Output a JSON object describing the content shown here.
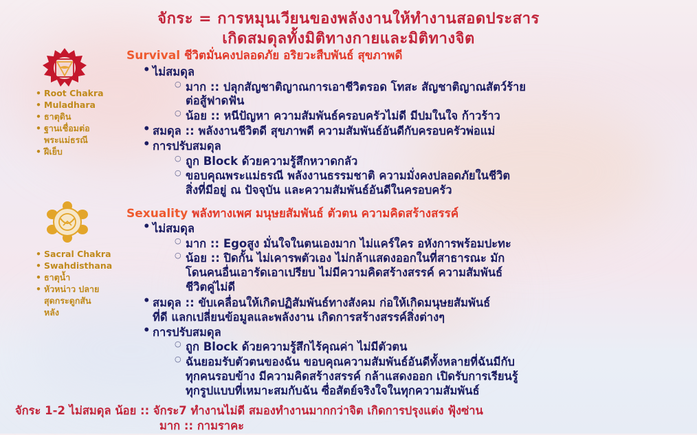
{
  "title": {
    "line1": "จักระ = การหมุนเวียนของพลังงานให้ทำงานสอดประสาร",
    "line2": "เกิดสมดุลทั้งมิติทางกายและมิติทางจิต"
  },
  "root": {
    "heading_en": "Survival",
    "heading_th": "ชีวิตมั่นคงปลอดภัย อริยวะสืบพันธ์ สุขภาพดี",
    "side_items": [
      "Root Chakra",
      "Muladhara",
      "ธาตุดิน",
      "ฐานเชื่อมต่อ",
      "พระแม่ธรณี",
      "ฝีเย็บ"
    ],
    "imbalance_label": "ไม่สมดุล",
    "excess": "มาก :: ปลุกสัญชาติญาณการเอาชีวิตรอด โทสะ สัญชาติญาณสัตว์ร้าย",
    "excess_cont": "ต่อสู้ฟาดฟัน",
    "deficient": "น้อย :: หนีปัญหา ความสัมพันธ์ครอบครัวไม่ดี มีปมในใจ ก้าวร้าว",
    "balance": "สมดุล :: พลังงานชีวิตดี สุขภาพดี ความสัมพันธ์อันดีกับครอบครัวพ่อแม่",
    "adjust_label": "การปรับสมดุล",
    "block": "ถูก Block ด้วยความรู้สึกหวาดกลัว",
    "adjust": "ขอบคุณพระแม่ธรณี พลังงานธรรมชาติ ความมั่งคงปลอดภัยในชีวิต",
    "adjust_cont": "สิ่งที่มีอยู่ ณ ปัจจุบัน และความสัมพันธ์อันดีในครอบครัว"
  },
  "sacral": {
    "heading_en": "Sexuality",
    "heading_th": "พลังทางเพศ มนุษยสัมพันธ์ ตัวตน ความคิดสร้างสรรค์",
    "side_items": [
      "Sacral Chakra",
      "Swahdisthana",
      "ธาตุน้ำ",
      "หัวหน่าว ปลาย",
      "สุดกระดูกสัน",
      "หลัง"
    ],
    "imbalance_label": "ไม่สมดุล",
    "excess": "มาก :: Egoสูง มั่นใจในตนเองมาก ไม่แคร์ใคร อหังการพร้อมปะทะ",
    "deficient": "น้อย :: ปิดกั้น ไม่เคารพตัวเอง ไม่กล้าแสดงออกในที่สาธารณะ มัก",
    "deficient_cont1": "โดนคนอื่นเอารัดเอาเปรียบ ไม่มีความคิดสร้างสรรค์ ความสัมพันธ์",
    "deficient_cont2": "ชีวิตคู่ไม่ดี",
    "balance": "สมดุล :: ขับเคลื่อนให้เกิดปฏิสัมพันธ์ทางสังคม ก่อให้เกิดมนุษยสัมพันธ์",
    "balance_cont": "ที่ดี แลกเปลี่ยนข้อมูลและพลังงาน เกิดการสร้างสรรค์สิ่งต่างๆ",
    "adjust_label": "การปรับสมดุล",
    "block": "ถูก Block ด้วยความรู้สึกไร้คุณค่า ไม่มีตัวตน",
    "adjust": "ฉันยอมรับตัวตนของฉัน ขอบคุณความสัมพันธ์อันดีทั้งหลายที่ฉันมีกับ",
    "adjust_cont1": "ทุกคนรอบข้าง มีความคิดสร้างสรรค์ กล้าแสดงออก เปิดรับการเรียนรู้",
    "adjust_cont2": "ทุกรูปแบบที่เหมาะสมกับฉัน ซื่อสัตย์จริงใจในทุกความสัมพันธ์"
  },
  "footer": {
    "line1": "จักระ 1-2 ไม่สมดุล น้อย :: จักระ7 ทำงานไม่ดี สมองทำงานมากกว่าจิต เกิดการปรุงแต่ง ฟุ้งซ่าน",
    "line2": "มาก :: กามราคะ"
  },
  "colors": {
    "title": "#c2263b",
    "heading_en": "#ee5a2f",
    "body": "#1c1d62",
    "side": "#c08a1c",
    "root_symbol": "#c4172c",
    "sacral_symbol": "#e3a52a"
  },
  "icons": [
    "root-chakra-icon",
    "sacral-chakra-icon"
  ]
}
